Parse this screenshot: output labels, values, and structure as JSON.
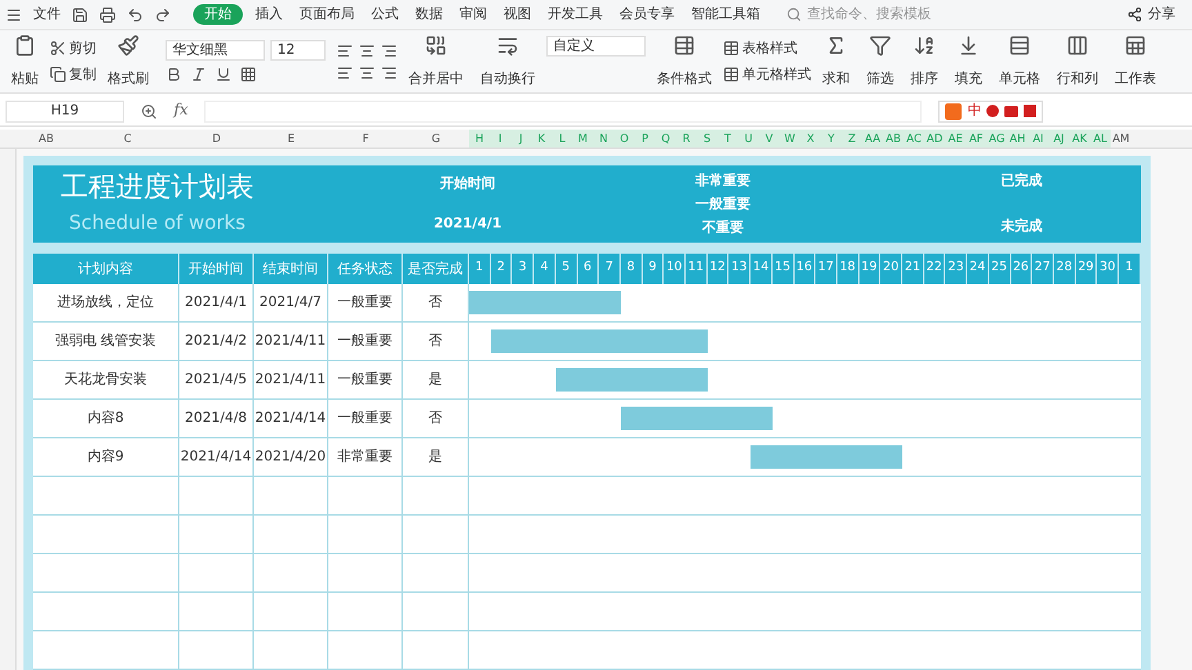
{
  "menu_bar": {
    "file_menu": "文件",
    "tabs": [
      {
        "label": "开始",
        "selected": true
      },
      {
        "label": "插入",
        "selected": false
      },
      {
        "label": "页面布局",
        "selected": false
      },
      {
        "label": "公式",
        "selected": false
      },
      {
        "label": "数据",
        "selected": false
      },
      {
        "label": "审阅",
        "selected": false
      },
      {
        "label": "视图",
        "selected": false
      },
      {
        "label": "开发工具",
        "selected": false
      },
      {
        "label": "会员专享",
        "selected": false
      },
      {
        "label": "智能工具箱",
        "selected": false
      }
    ],
    "search": {
      "placeholder": "查找命令、搜索模板"
    },
    "share": "分享"
  },
  "ribbon": {
    "paste": "粘贴",
    "cut": "剪切",
    "copy": "复制",
    "format_painter": "格式刷",
    "font": "华文细黑",
    "font_size": "12",
    "merge": "合并居中",
    "wrap": "自动换行",
    "number_format": "自定义",
    "conditional": "条件格式",
    "table_style": "表格样式",
    "cell_style": "单元格样式",
    "sum": "求和",
    "filter": "筛选",
    "sort": "排序",
    "fill": "填充",
    "cells": "单元格",
    "rows_cols": "行和列",
    "sheet": "工作表"
  },
  "ime_bar": {
    "mode": "中"
  },
  "formula_bar": {
    "cell_ref": "H19",
    "fx": "fx"
  },
  "column_headers": [
    {
      "label": "AB",
      "selected": false
    },
    {
      "label": "C",
      "selected": false
    },
    {
      "label": "D",
      "selected": false
    },
    {
      "label": "E",
      "selected": false
    },
    {
      "label": "F",
      "selected": false
    },
    {
      "label": "G",
      "selected": false
    },
    {
      "label": "H",
      "selected": true
    },
    {
      "label": "I",
      "selected": true
    },
    {
      "label": "J",
      "selected": true
    },
    {
      "label": "K",
      "selected": true
    },
    {
      "label": "L",
      "selected": true
    },
    {
      "label": "M",
      "selected": true
    },
    {
      "label": "N",
      "selected": true
    },
    {
      "label": "O",
      "selected": true
    },
    {
      "label": "P",
      "selected": true
    },
    {
      "label": "Q",
      "selected": true
    },
    {
      "label": "R",
      "selected": true
    },
    {
      "label": "S",
      "selected": true
    },
    {
      "label": "T",
      "selected": true
    },
    {
      "label": "U",
      "selected": true
    },
    {
      "label": "V",
      "selected": true
    },
    {
      "label": "W",
      "selected": true
    },
    {
      "label": "X",
      "selected": true
    },
    {
      "label": "Y",
      "selected": true
    },
    {
      "label": "Z",
      "selected": true
    },
    {
      "label": "AA",
      "selected": true
    },
    {
      "label": "AB",
      "selected": true
    },
    {
      "label": "AC",
      "selected": true
    },
    {
      "label": "AD",
      "selected": true
    },
    {
      "label": "AE",
      "selected": true
    },
    {
      "label": "AF",
      "selected": true
    },
    {
      "label": "AG",
      "selected": true
    },
    {
      "label": "AH",
      "selected": true
    },
    {
      "label": "AI",
      "selected": true
    },
    {
      "label": "AJ",
      "selected": true
    },
    {
      "label": "AK",
      "selected": true
    },
    {
      "label": "AL",
      "selected": true
    },
    {
      "label": "AM",
      "selected": false
    }
  ],
  "sheet": {
    "title": "工程进度计划表",
    "subtitle": "Schedule of works",
    "start_label": "开始时间",
    "start_date": "2021/4/1",
    "legend_status": [
      "非常重要",
      "一般重要",
      "不重要"
    ],
    "legend_done": [
      "已完成",
      "未完成"
    ],
    "columns": [
      "计划内容",
      "开始时间",
      "结束时间",
      "任务状态",
      "是否完成"
    ],
    "days": [
      "1",
      "2",
      "3",
      "4",
      "5",
      "6",
      "7",
      "8",
      "9",
      "10",
      "11",
      "12",
      "13",
      "14",
      "15",
      "16",
      "17",
      "18",
      "19",
      "20",
      "21",
      "22",
      "23",
      "24",
      "25",
      "26",
      "27",
      "28",
      "29",
      "30",
      "1"
    ],
    "rows": [
      {
        "task": "进场放线，定位",
        "start": "2021/4/1",
        "end": "2021/4/7",
        "status": "一般重要",
        "done": "否"
      },
      {
        "task": "强弱电 线管安装",
        "start": "2021/4/2",
        "end": "2021/4/11",
        "status": "一般重要",
        "done": "否"
      },
      {
        "task": "天花龙骨安装",
        "start": "2021/4/5",
        "end": "2021/4/11",
        "status": "一般重要",
        "done": "是"
      },
      {
        "task": "内容8",
        "start": "2021/4/8",
        "end": "2021/4/14",
        "status": "一般重要",
        "done": "否"
      },
      {
        "task": "内容9",
        "start": "2021/4/14",
        "end": "2021/4/20",
        "status": "非常重要",
        "done": "是"
      }
    ]
  }
}
